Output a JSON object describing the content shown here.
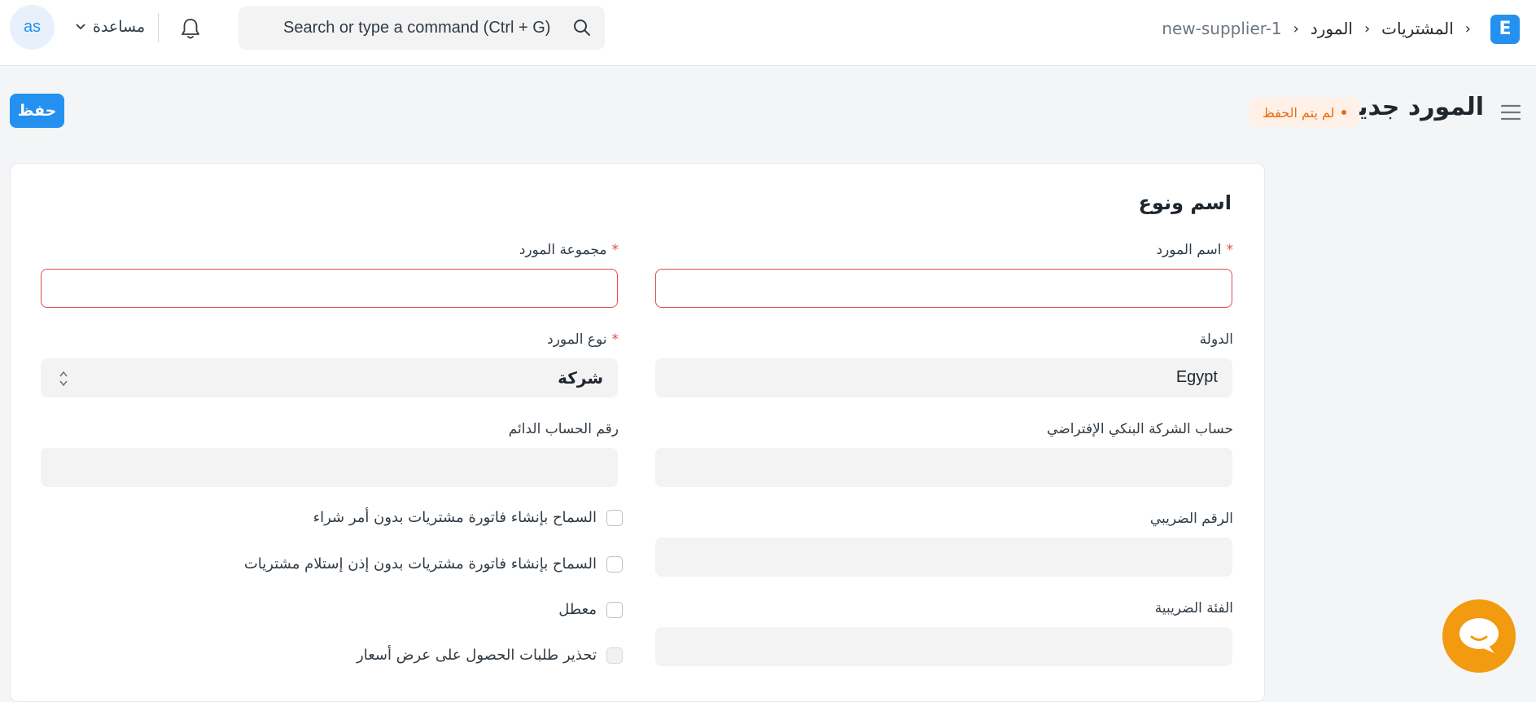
{
  "navbar": {
    "logo_letter": "E",
    "breadcrumbs": [
      "المشتريات",
      "المورد",
      "new-supplier-1"
    ],
    "search_placeholder": "Search or type a command (Ctrl + G)",
    "help_label": "مساعدة",
    "avatar_initials": "as"
  },
  "page": {
    "title": "المورد جديد",
    "status": "لم يتم الحفظ",
    "save_label": "حفظ"
  },
  "form": {
    "section_title": "اسم ونوع",
    "supplier_name": {
      "label": "اسم المورد",
      "value": ""
    },
    "supplier_group": {
      "label": "مجموعة المورد",
      "value": ""
    },
    "country": {
      "label": "الدولة",
      "value": "Egypt"
    },
    "supplier_type": {
      "label": "نوع المورد",
      "value": "شركة"
    },
    "default_bank_account": {
      "label": "حساب الشركة البنكي الإفتراضي",
      "value": ""
    },
    "permanent_account_number": {
      "label": "رقم الحساب الدائم",
      "value": ""
    },
    "tax_id": {
      "label": "الرقم الضريبي",
      "value": ""
    },
    "tax_category": {
      "label": "الفئة الضريبية",
      "value": ""
    },
    "checkboxes": [
      {
        "label": "السماح بإنشاء فاتورة مشتريات بدون أمر شراء",
        "checked": false
      },
      {
        "label": "السماح بإنشاء فاتورة مشتريات بدون إذن إستلام مشتريات",
        "checked": false
      },
      {
        "label": "معطل",
        "checked": false
      },
      {
        "label": "تحذير طلبات الحصول على عرض أسعار",
        "checked": false
      }
    ],
    "required_marker": "*"
  },
  "colors": {
    "primary": "#2490ef",
    "warning": "#e86c13",
    "required": "#e24c4c",
    "chat_bubble": "#f29a10"
  },
  "icons": [
    "logo-icon",
    "search-icon",
    "bell-icon",
    "chevron-down-icon",
    "hamburger-icon",
    "select-arrows-icon",
    "chat-icon"
  ]
}
